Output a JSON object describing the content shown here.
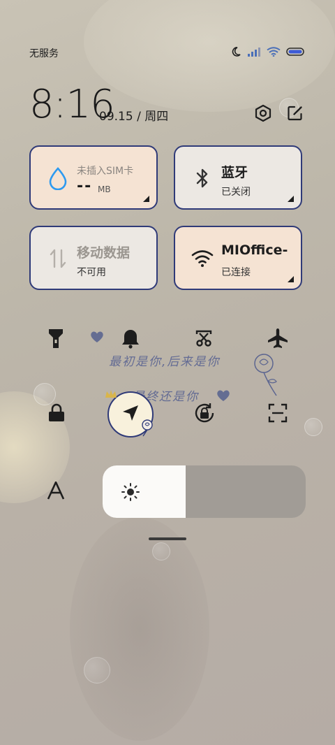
{
  "status_bar": {
    "carrier": "无服务"
  },
  "header": {
    "time": "8:16",
    "date": "09.15 / 周四"
  },
  "tiles": {
    "data": {
      "title": "未插入SIM卡",
      "value": "--",
      "unit": "MB"
    },
    "bluetooth": {
      "title": "蓝牙",
      "status": "已关闭"
    },
    "mobile_data": {
      "title": "移动数据",
      "status": "不可用"
    },
    "wifi": {
      "title": "MIOffice-",
      "status": "已连接"
    }
  },
  "decoration": {
    "line1": "最初是你,后来是你",
    "line2": "最终还是你"
  },
  "brightness": {
    "level": 0.41
  },
  "colors": {
    "tile_border": "#2f3a78",
    "tile_active": "#f5e3d3",
    "tile_inactive": "#ece8e3",
    "accent_blue": "#2d9af0"
  }
}
